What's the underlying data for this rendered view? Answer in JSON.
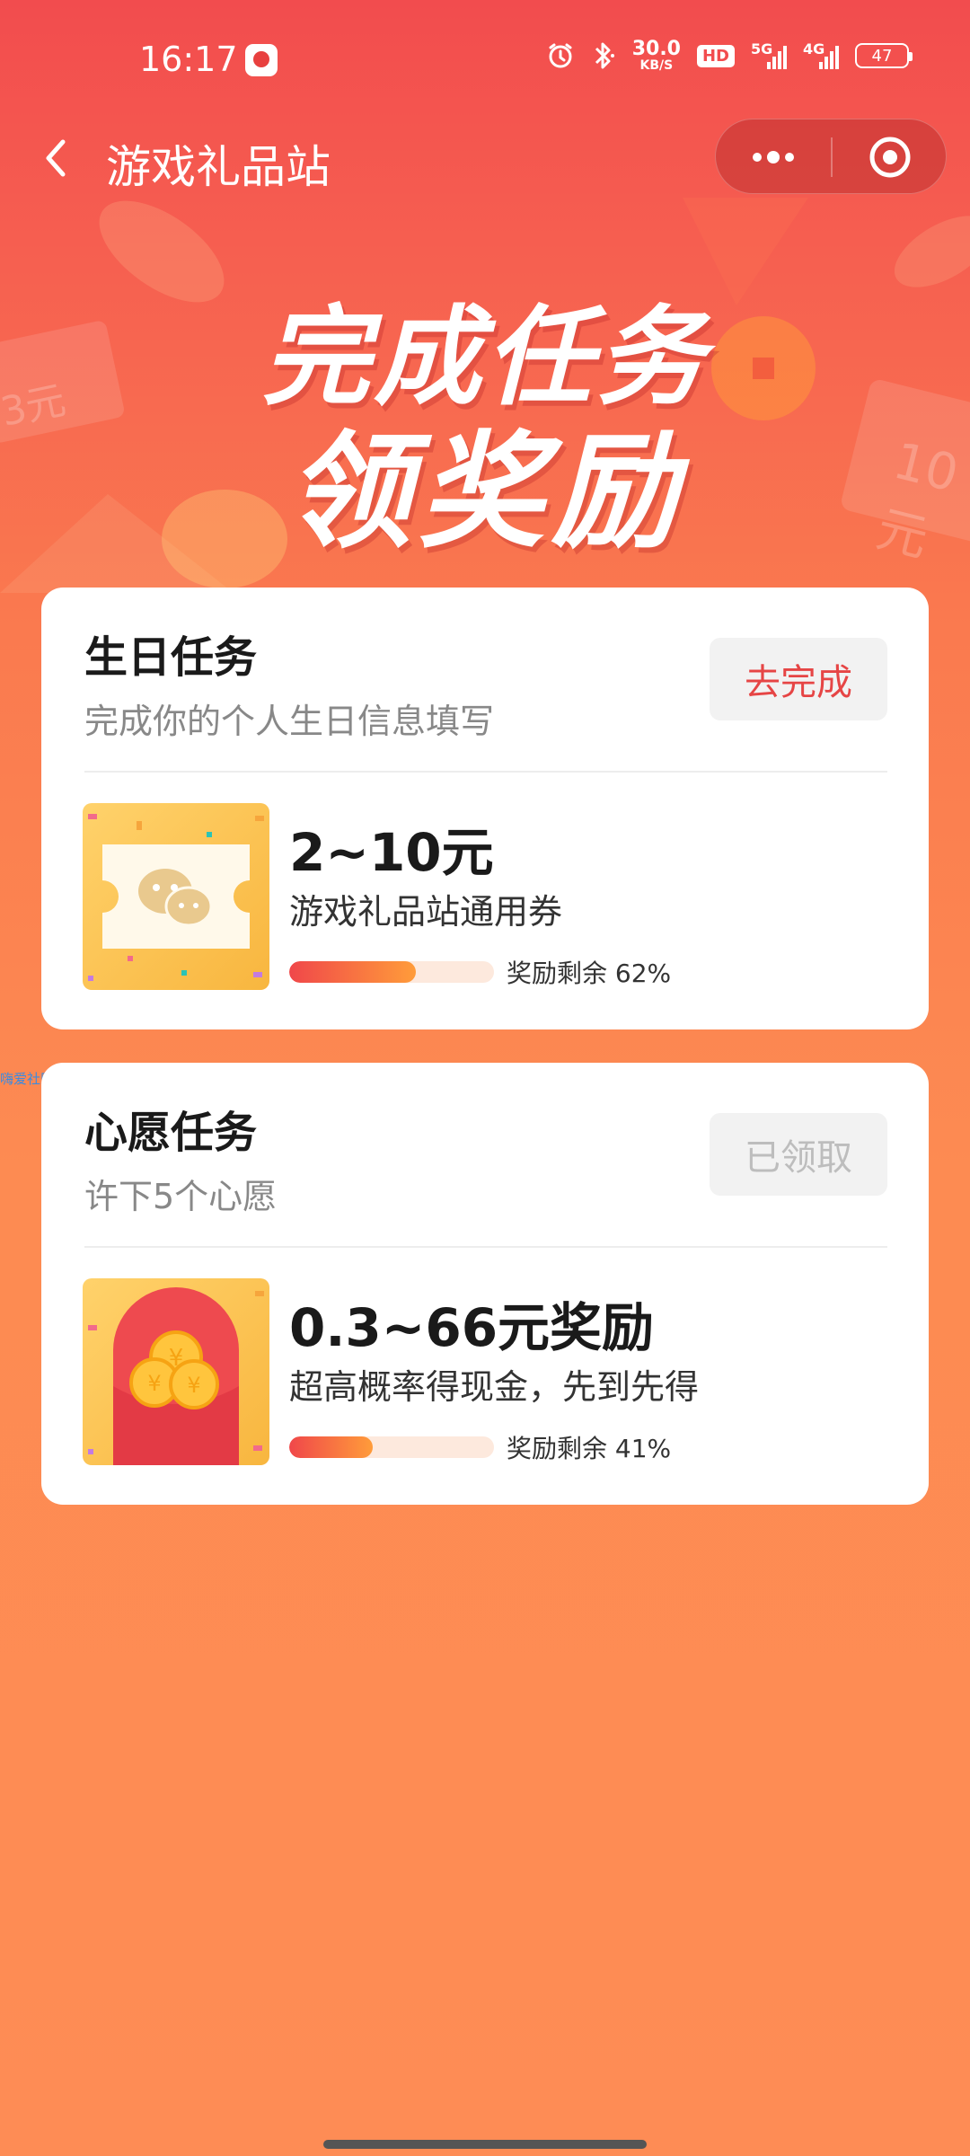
{
  "status_bar": {
    "time": "16:17",
    "speed_value": "30.0",
    "speed_unit": "KB/S",
    "hd_label": "HD",
    "net1": "5G",
    "net2": "4G",
    "battery": "47",
    "icons": [
      "app-notification-icon",
      "alarm-icon",
      "bluetooth-icon",
      "hd-icon",
      "signal-5g-icon",
      "signal-4g-icon",
      "battery-icon"
    ]
  },
  "nav": {
    "title": "游戏礼品站",
    "back_icon": "chevron-left-icon",
    "more_icon": "more-dots-icon",
    "close_icon": "target-close-icon"
  },
  "banner": {
    "line1": "完成任务",
    "line2": "领奖励",
    "deco_left": "3元",
    "deco_right": "10元"
  },
  "tasks": [
    {
      "title": "生日任务",
      "desc": "完成你的个人生日信息填写",
      "button": "去完成",
      "button_state": "active",
      "reward_amount": "2~10元",
      "reward_desc": "游戏礼品站通用券",
      "progress": 0.62,
      "progress_label": "奖励剩余 62%",
      "icon": "wechat-coupon-icon"
    },
    {
      "title": "心愿任务",
      "desc": "许下5个心愿",
      "button": "已领取",
      "button_state": "done",
      "reward_amount": "0.3~66元奖励",
      "reward_desc": "超高概率得现金，先到先得",
      "progress": 0.41,
      "progress_label": "奖励剩余 41%",
      "icon": "red-envelope-coins-icon"
    }
  ],
  "watermark": "嗨爱社区",
  "colors": {
    "accent_red": "#E64545",
    "bg_top": "#F24C4E",
    "bg_bottom": "#FE8C55",
    "progress_start": "#F0474A",
    "progress_end": "#FF9C3A"
  }
}
